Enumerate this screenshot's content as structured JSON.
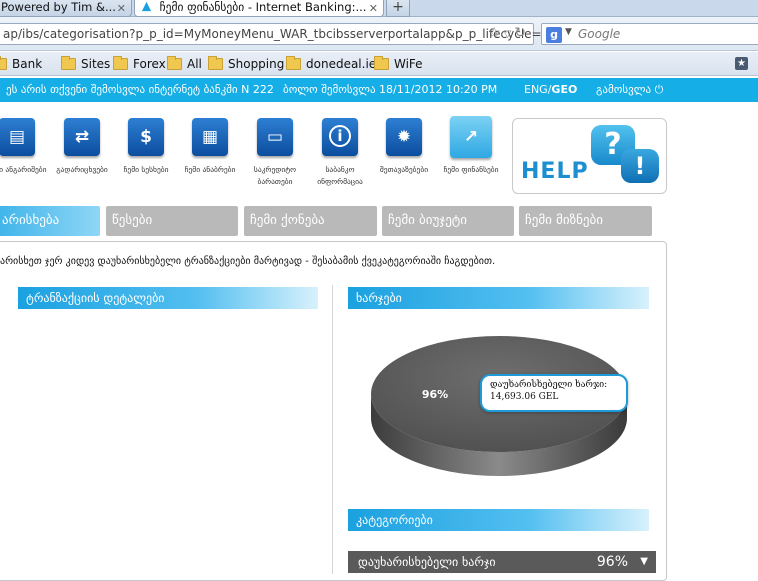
{
  "browser": {
    "tabs": [
      {
        "title": "Powered by Tim &...",
        "active": false
      },
      {
        "title": "ჩემი ფინანსები - Internet Banking:...",
        "active": true
      }
    ],
    "new_tab_symbol": "+",
    "url": "ap/ibs/categorisation?p_p_id=MyMoneyMenu_WAR_tbcibsserverportalapp&p_p_lifecycle=",
    "search_placeholder": "Google",
    "bookmarks": [
      {
        "label": "Bank"
      },
      {
        "label": "Sites"
      },
      {
        "label": "Forex"
      },
      {
        "label": "All"
      },
      {
        "label": "Shopping"
      },
      {
        "label": "donedeal.ie"
      },
      {
        "label": "WiFe"
      }
    ]
  },
  "site_bar": {
    "notice": "ეს არის თქვენი შემოსვლა ინტერნეტ ბანკში N 222",
    "last_login": "ბოლო შემოსვლა 18/11/2012 10:20 PM",
    "lang_eng": "ENG/",
    "lang_geo": "GEO",
    "logout": "გამოსვლა"
  },
  "menu": [
    {
      "label": "ჩემი ანგარიშები",
      "icon": "accounts-icon",
      "glyph": "▤"
    },
    {
      "label": "გადარიცხვები",
      "icon": "transfer-icon",
      "glyph": "⇄"
    },
    {
      "label": "ჩემი სესხები",
      "icon": "loans-icon",
      "glyph": "$"
    },
    {
      "label": "ჩემი ანაბრები",
      "icon": "deposits-icon",
      "glyph": "▦"
    },
    {
      "label": "საკრედიტო ბარათები",
      "icon": "credit-card-icon",
      "glyph": "▭"
    },
    {
      "label": "საბანკო ინფორმაცია",
      "icon": "info-icon",
      "glyph": "i"
    },
    {
      "label": "შეთავაზებები",
      "icon": "offers-icon",
      "glyph": "✹"
    },
    {
      "label": "ჩემი ფინანსები",
      "icon": "finances-icon",
      "glyph": "↗",
      "active": true
    }
  ],
  "help": {
    "text": "HELP",
    "q": "?",
    "e": "!"
  },
  "subtabs": [
    {
      "label": "არისხება",
      "active": true
    },
    {
      "label": "წესები"
    },
    {
      "label": "ჩემი ქონება"
    },
    {
      "label": "ჩემი ბიუჯეტი"
    },
    {
      "label": "ჩემი მიზნები"
    }
  ],
  "content": {
    "notice": "არისხეთ ჯერ კიდევ დაუხარისხებელი ტრანზაქციები მარტივად - შესაბამის ქვეკატეგორიაში ჩაგდებით.",
    "transaction_details_title": "ტრანზაქციის დეტალები",
    "expenses_title": "ხარჯები",
    "categories_title": "კატეგორიები"
  },
  "chart_data": {
    "type": "pie",
    "slices": [
      {
        "label": "დაუხარისხებელი ხარჯი",
        "percent": 96,
        "amount": "14,693.06 GEL",
        "color": "#5f5f5f"
      }
    ],
    "data_label": "96%",
    "tooltip_line1": "დაუხარისხებელი ხარჯი:",
    "tooltip_line2": "14,693.06 GEL",
    "style": "3d"
  },
  "category_row": {
    "label": "დაუხარისხებელი ხარჯი",
    "percent": "96%",
    "caret": "▼"
  }
}
